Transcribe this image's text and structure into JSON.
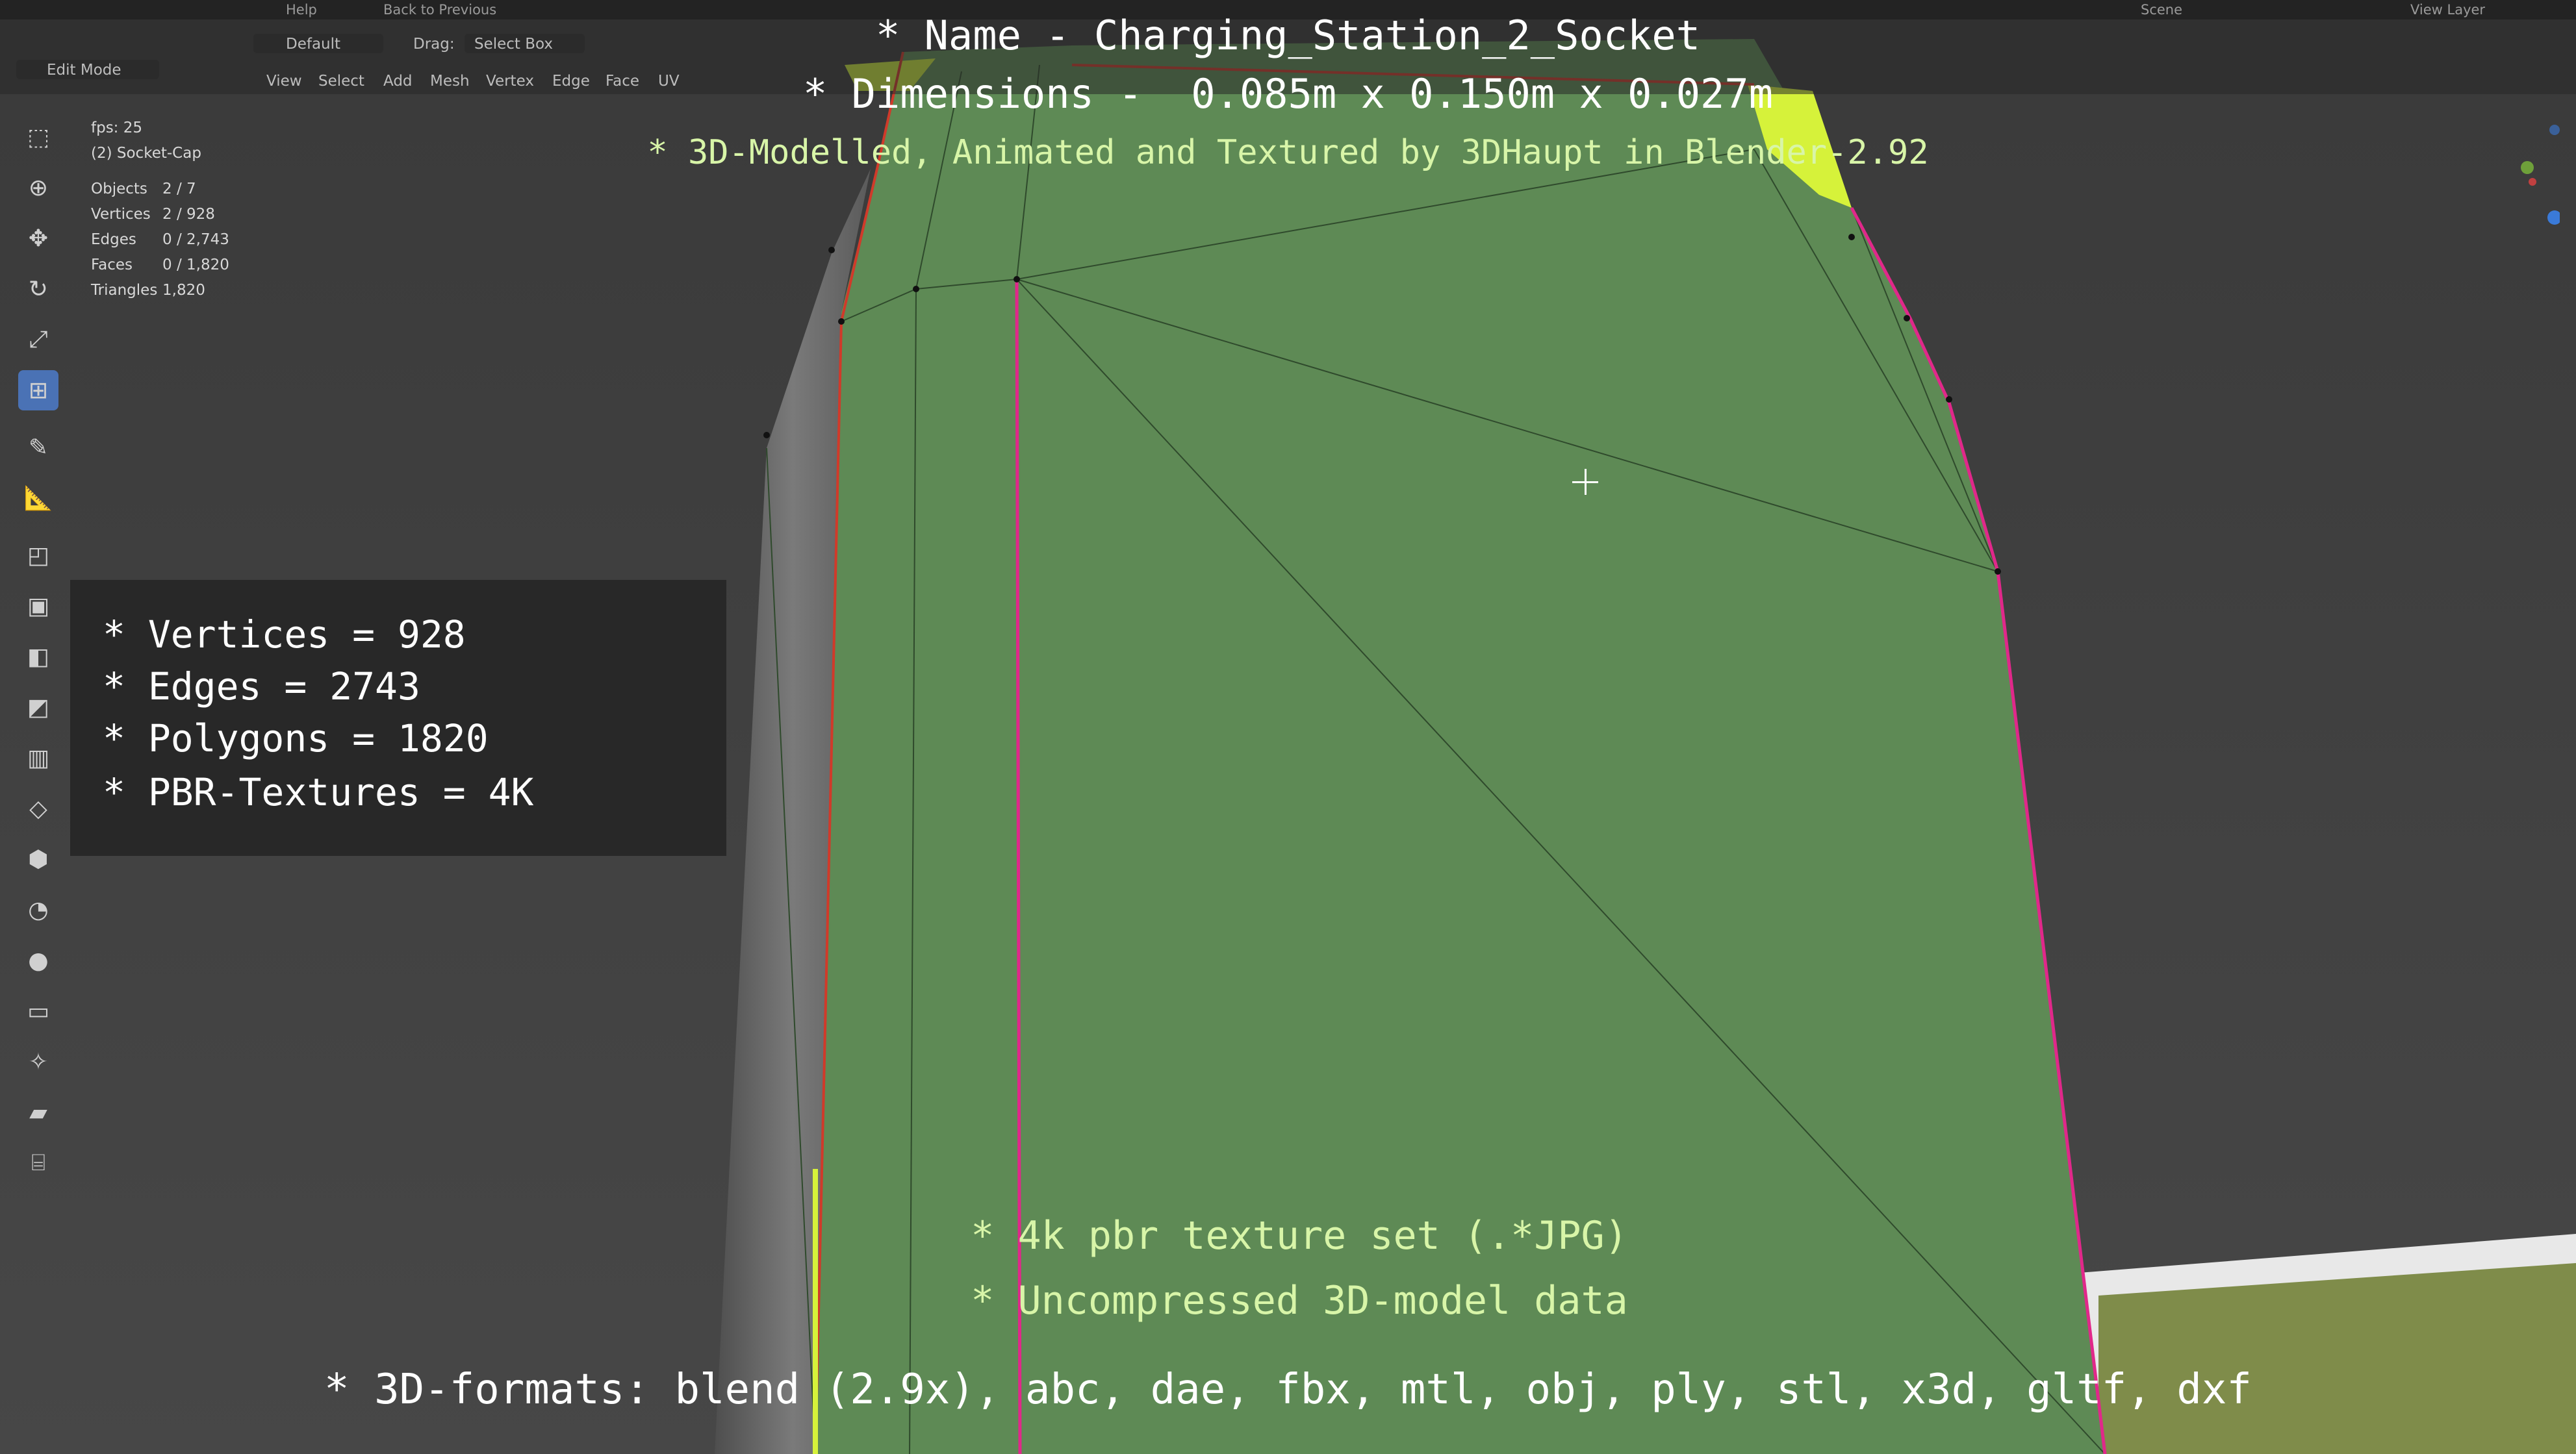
{
  "overlay": {
    "name_line": "* Name - Charging_Station_2_Socket",
    "dimensions_line": "* Dimensions -  0.085m x 0.150m x 0.027m",
    "credit_line": "* 3D-Modelled, Animated and Textured by 3DHaupt in Blender-2.92",
    "specs": [
      "* Vertices = 928",
      "* Edges = 2743",
      "* Polygons = 1820",
      "* PBR-Textures = 4K"
    ],
    "texture_line": "* 4k pbr texture set (.*JPG)",
    "uncompressed_line": "* Uncompressed 3D-model data",
    "formats_line": "* 3D-formats: blend (2.9x), abc, dae, fbx, mtl, obj, ply, stl, x3d, gltf, dxf"
  },
  "topbar": {
    "help": "Help",
    "back": "Back to Previous",
    "scene": "Scene",
    "view_layer": "View Layer"
  },
  "header": {
    "mode": "Edit Mode",
    "orientation": "Default",
    "drag_label": "Drag:",
    "drag_value": "Select Box",
    "menus": [
      "View",
      "Select",
      "Add",
      "Mesh",
      "Vertex",
      "Edge",
      "Face",
      "UV"
    ]
  },
  "viewport_stats": {
    "fps": "fps: 25",
    "object": "(2) Socket-Cap",
    "rows": [
      {
        "k": "Objects",
        "v": "2 / 7"
      },
      {
        "k": "Vertices",
        "v": "2 / 928"
      },
      {
        "k": "Edges",
        "v": "0 / 2,743"
      },
      {
        "k": "Faces",
        "v": "0 / 1,820"
      },
      {
        "k": "Triangles",
        "v": "1,820"
      }
    ]
  },
  "colors": {
    "mesh_face": "#5e8a55",
    "mesh_side": "#6a6a6a",
    "wire": "#2a3a28",
    "seam": "#e0288a",
    "edge_red": "#d03a2a",
    "selected": "#d6f23a",
    "accent": "#4a72b5"
  },
  "icons": {
    "toolbar": [
      "select-box-icon",
      "cursor-icon",
      "move-icon",
      "rotate-icon",
      "scale-icon",
      "transform-icon",
      "annotate-icon",
      "measure-icon",
      "add-cube-icon",
      "extrude-icon",
      "inset-icon",
      "bevel-icon",
      "loop-cut-icon",
      "knife-icon",
      "poly-build-icon",
      "spin-icon",
      "smooth-icon",
      "edge-slide-icon",
      "shrink-icon",
      "shear-icon",
      "rip-icon"
    ]
  }
}
